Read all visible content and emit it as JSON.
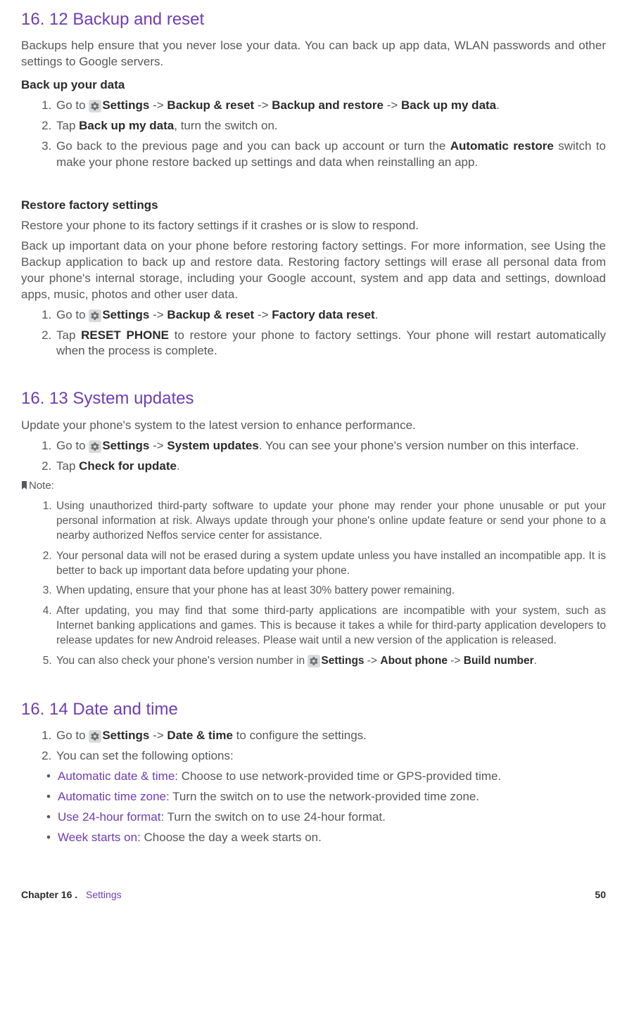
{
  "sections": {
    "backup": {
      "heading": "16. 12  Backup and reset",
      "intro": "Backups help ensure that you never lose your data. You can back up app data, WLAN passwords and other settings to Google servers.",
      "sub1_heading": "Back up your data",
      "step1_a": "Go to ",
      "step1_b": "Settings",
      "step1_c": " -> ",
      "step1_d": "Backup & reset",
      "step1_e": " -> ",
      "step1_f": "Backup and restore",
      "step1_g": " -> ",
      "step1_h": "Back up my data",
      "step1_i": ".",
      "step2_a": "Tap ",
      "step2_b": "Back up my data",
      "step2_c": ", turn the switch on.",
      "step3_a": "Go back to the previous page and you can back up account or turn the ",
      "step3_b": "Automatic restore",
      "step3_c": " switch to make your phone restore backed up settings and data when reinstalling an app.",
      "sub2_heading": "Restore factory settings",
      "restore_p1": "Restore your phone to its factory settings if it crashes or is slow to respond.",
      "restore_p2": "Back up important data on your phone before restoring factory settings. For more information, see Using the Backup application to back up and restore data. Restoring factory settings will erase all personal data from your phone's internal storage, including your Google account, system and app data and settings, download apps, music, photos and other user data.",
      "rstep1_a": "Go to ",
      "rstep1_b": "Settings",
      "rstep1_c": " -> ",
      "rstep1_d": "Backup & reset",
      "rstep1_e": " -> ",
      "rstep1_f": "Factory data reset",
      "rstep1_g": ".",
      "rstep2_a": "Tap ",
      "rstep2_b": "RESET PHONE",
      "rstep2_c": " to restore your phone to factory settings. Your phone will restart automatically when the process is complete."
    },
    "updates": {
      "heading": "16. 13  System updates",
      "intro": "Update your phone's system to the latest version to enhance performance.",
      "step1_a": "Go to ",
      "step1_b": "Settings",
      "step1_c": " -> ",
      "step1_d": "System updates",
      "step1_e": ". You can see your phone's version number on this interface.",
      "step2_a": "Tap ",
      "step2_b": "Check for update",
      "step2_c": ".",
      "note_label": "Note:",
      "note1": "Using unauthorized third-party software to update your phone may render your phone unusable or put your personal information at risk. Always update through your phone's online update feature or send your phone to a nearby authorized Neffos service center for assistance.",
      "note2": "Your personal data will not be erased during a system update unless you have installed an incompatible app. It is better to back up important data before updating your phone.",
      "note3": "When updating, ensure that your phone has at least 30% battery power remaining.",
      "note4": "After updating, you may find that some third-party applications are incompatible with your system, such as Internet banking applications and games. This is because it takes a while for third-party application developers to release updates for new Android releases. Please wait until a new version of the application is released.",
      "note5_a": "You can also check your phone's version number in ",
      "note5_b": "Settings",
      "note5_c": " -> ",
      "note5_d": "About phone",
      "note5_e": " -> ",
      "note5_f": "Build number",
      "note5_g": "."
    },
    "datetime": {
      "heading": "16. 14  Date and time",
      "step1_a": "Go to ",
      "step1_b": "Settings",
      "step1_c": " -> ",
      "step1_d": "Date & time",
      "step1_e": " to configure the settings.",
      "step2": "You can set the following options:",
      "b1_t": "Automatic date & time:",
      "b1_r": " Choose to use network-provided time or GPS-provided time.",
      "b2_t": "Automatic time zone:",
      "b2_r": " Turn the switch on to use the network-provided time zone.",
      "b3_t": "Use 24-hour format:",
      "b3_r": " Turn the switch on to use 24-hour format.",
      "b4_t": "Week starts on:",
      "b4_r": " Choose the day a week starts on."
    }
  },
  "footer": {
    "chapter": "Chapter 16 .",
    "settings": "Settings",
    "page": "50"
  }
}
